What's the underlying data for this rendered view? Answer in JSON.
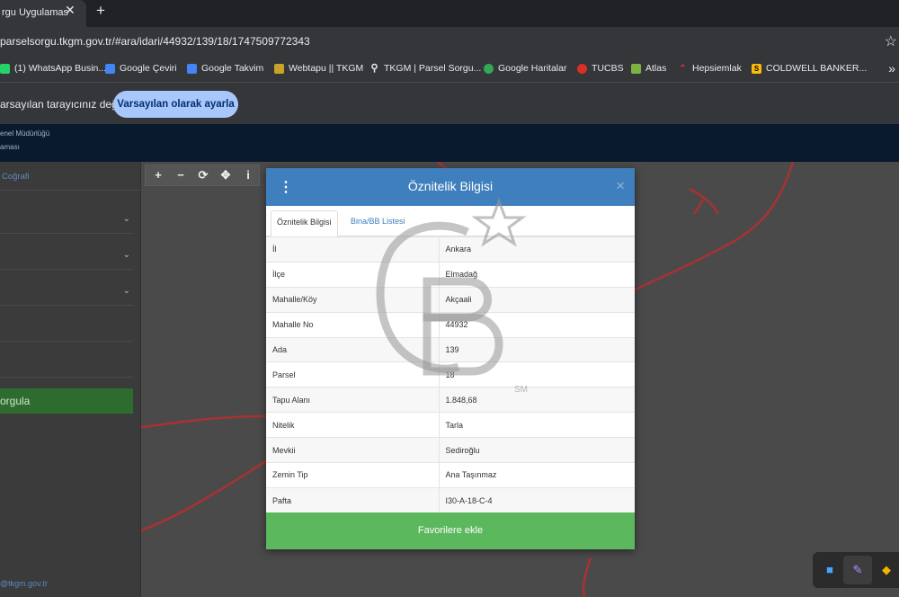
{
  "browser": {
    "tab_title": "rgu Uygulamas",
    "tab_close": "✕",
    "new_tab": "+",
    "url": "parselsorgu.tkgm.gov.tr/#ara/idari/44932/139/18/1747509772343",
    "bookmark_star": "☆",
    "bookmarks": [
      {
        "label": "(1) WhatsApp Busin...",
        "icon": "whatsapp-icon",
        "color": "#25d366"
      },
      {
        "label": "Google Çeviri",
        "icon": "google-translate-icon",
        "color": "#4285f4"
      },
      {
        "label": "Google Takvim",
        "icon": "google-calendar-icon",
        "color": "#4285f4"
      },
      {
        "label": "Webtapu || TKGM",
        "icon": "webtapu-icon",
        "color": "#c9a227"
      },
      {
        "label": "TKGM | Parsel Sorgu...",
        "icon": "location-pin-icon",
        "color": "#e8eaed"
      },
      {
        "label": "Google Haritalar",
        "icon": "google-maps-icon",
        "color": "#34a853"
      },
      {
        "label": "TUCBS",
        "icon": "tucbs-icon",
        "color": "#d93025"
      },
      {
        "label": "Atlas",
        "icon": "atlas-icon",
        "color": "#7cb342"
      },
      {
        "label": "Hepsiemlak",
        "icon": "hepsiemlak-icon",
        "color": "#e53935"
      },
      {
        "label": "COLDWELL BANKER...",
        "icon": "coldwell-banker-icon",
        "color": "#fbbc04"
      }
    ],
    "bookmarks_more": "»",
    "infobar_text": "arsayılan tarayıcınız değil",
    "infobar_button": "Varsayılan olarak ayarla"
  },
  "site": {
    "header_line1": "enel Müdürlüğü",
    "header_line2": "aması",
    "sidebar_tab": "Coğrafi",
    "query_button": "orgula",
    "footer": "@tkgm.gov.tr"
  },
  "map_tools": [
    "+",
    "−",
    "⟳",
    "✥",
    "i"
  ],
  "dialog": {
    "title": "Öznitelik Bilgisi",
    "close": "×",
    "menu": "⋮",
    "tabs": [
      "Öznitelik Bilgisi",
      "Bina/BB Listesi"
    ],
    "rows": [
      {
        "key": "İl",
        "value": "Ankara"
      },
      {
        "key": "İlçe",
        "value": "Elmadağ"
      },
      {
        "key": "Mahalle/Köy",
        "value": "Akçaali"
      },
      {
        "key": "Mahalle No",
        "value": "44932"
      },
      {
        "key": "Ada",
        "value": "139"
      },
      {
        "key": "Parsel",
        "value": "18"
      },
      {
        "key": "Tapu Alanı",
        "value": "1.848,68"
      },
      {
        "key": "Nitelik",
        "value": "Tarla"
      },
      {
        "key": "Mevkii",
        "value": "Sediroğlu"
      },
      {
        "key": "Zemin Tip",
        "value": "Ana Taşınmaz"
      },
      {
        "key": "Pafta",
        "value": "I30-A-18-C-4"
      }
    ],
    "footer_button": "Favorilere ekle"
  },
  "watermark": {
    "mark": "SM"
  },
  "colors": {
    "dialog_header": "#3f7fbd",
    "dialog_footer": "#5cb85c",
    "road": "#b52a2a",
    "query_button": "#2e6b2e"
  }
}
